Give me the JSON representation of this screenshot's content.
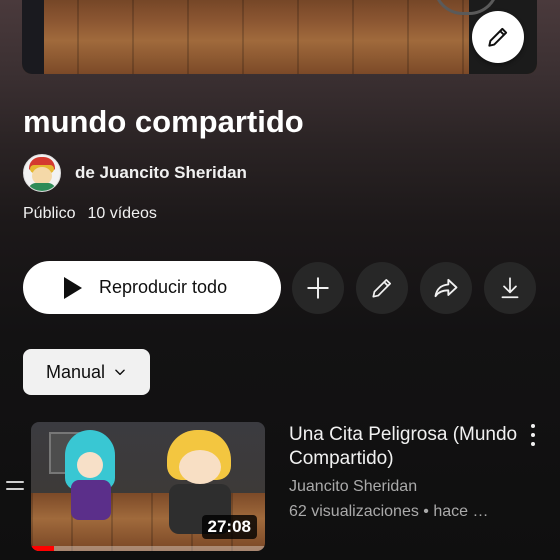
{
  "playlist": {
    "title": "mundo compartido",
    "owner": "de Juancito Sheridan",
    "visibility": "Público",
    "video_count": "10 vídeos"
  },
  "actions": {
    "play_all_label": "Reproducir todo",
    "icons": [
      "edit-icon",
      "add-icon",
      "pencil-icon",
      "share-icon",
      "download-icon"
    ]
  },
  "sort": {
    "label": "Manual"
  },
  "videos": [
    {
      "title": "Una Cita Peligrosa (Mundo Compartido)",
      "channel": "Juancito Sheridan",
      "stats": "62 visualizaciones • hace …",
      "duration": "27:08",
      "watched_fraction": 0.1
    }
  ],
  "colors": {
    "background": "#0f0f0f",
    "progress": "#ff0000",
    "button_dark": "#272727",
    "text_secondary": "#aaaaaa"
  }
}
